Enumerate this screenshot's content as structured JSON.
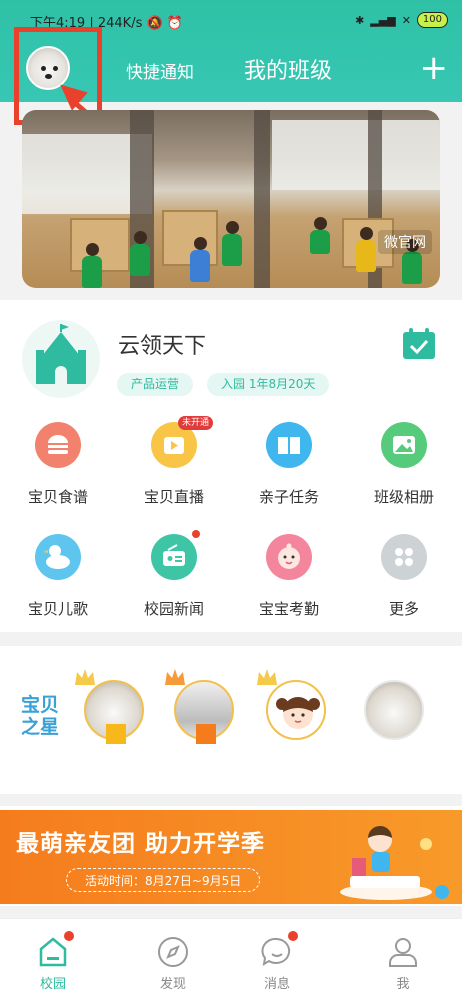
{
  "status_bar": {
    "time": "下午4:19",
    "net_speed": "244K/s",
    "battery": "100"
  },
  "header": {
    "quick_notice": "快捷通知",
    "title": "我的班级",
    "add_icon": "plus-icon"
  },
  "banner": {
    "label": "微官网"
  },
  "class_card": {
    "name": "云领天下",
    "tags": [
      "产品运营",
      "入园 1年8月20天"
    ],
    "logo_icon": "castle-icon",
    "checkin_icon": "calendar-check-icon"
  },
  "features": [
    {
      "label": "宝贝食谱",
      "icon": "burger-icon",
      "color": "#f2826d",
      "badge": ""
    },
    {
      "label": "宝贝直播",
      "icon": "tv-play-icon",
      "color": "#f9c547",
      "badge": "未开通"
    },
    {
      "label": "亲子任务",
      "icon": "book-icon",
      "color": "#3fb6ee",
      "badge": ""
    },
    {
      "label": "班级相册",
      "icon": "photo-icon",
      "color": "#56cb7c",
      "badge": ""
    },
    {
      "label": "宝贝儿歌",
      "icon": "duck-icon",
      "color": "#5ec6ee",
      "badge": ""
    },
    {
      "label": "校园新闻",
      "icon": "radio-icon",
      "color": "#3ec5a6",
      "badge": "dot"
    },
    {
      "label": "宝宝考勤",
      "icon": "baby-face-icon",
      "color": "#f3869c",
      "badge": ""
    },
    {
      "label": "更多",
      "icon": "grid-more-icon",
      "color": "#cdd3d5",
      "badge": ""
    }
  ],
  "stars": {
    "title_line1": "宝贝",
    "title_line2": "之星",
    "items": [
      {
        "avatar": "dog-avatar",
        "crown": "#f5c94a",
        "flag": "#f7b81b"
      },
      {
        "avatar": "gray-avatar",
        "crown": "#f79a3a",
        "flag": "#f57c1d"
      },
      {
        "avatar": "girl-avatar",
        "crown": "#f5c94a",
        "flag": ""
      },
      {
        "avatar": "dog-avatar",
        "crown": "",
        "flag": ""
      }
    ]
  },
  "promo": {
    "title": "最萌亲友团 助力开学季",
    "subtitle": "活动时间：8月27日~9月5日"
  },
  "tabbar": [
    {
      "label": "校园",
      "icon": "school-home-icon",
      "active": true,
      "dot": true
    },
    {
      "label": "发现",
      "icon": "compass-icon",
      "active": false,
      "dot": false
    },
    {
      "label": "消息",
      "icon": "chat-bubble-icon",
      "active": false,
      "dot": true
    },
    {
      "label": "我",
      "icon": "user-icon",
      "active": false,
      "dot": false
    }
  ]
}
